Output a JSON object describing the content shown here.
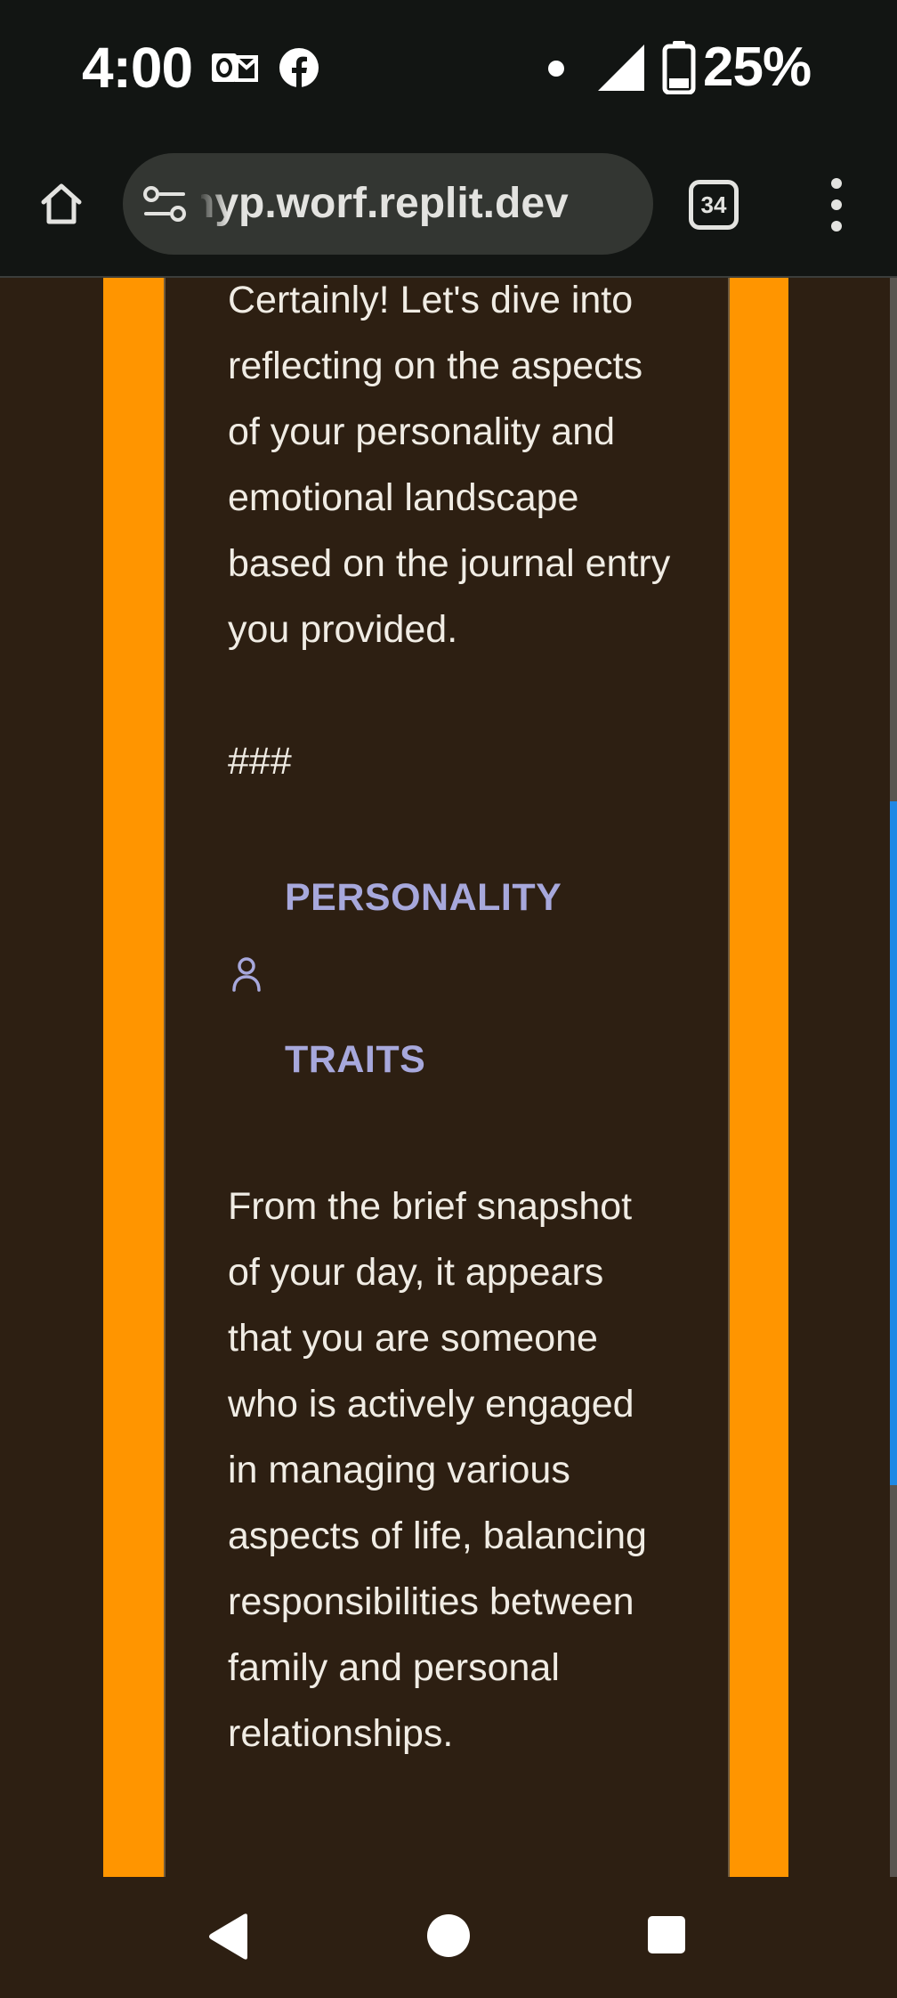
{
  "status_bar": {
    "time": "4:00",
    "battery_percent": "25%",
    "notification_icons": [
      "outlook-icon",
      "facebook-icon"
    ],
    "system_icons": [
      "dot-icon",
      "cell-signal-icon",
      "battery-icon"
    ]
  },
  "browser": {
    "url": "hyp.worf.replit.dev",
    "tab_count": "34",
    "icons": [
      "home-icon",
      "site-settings-icon",
      "tabs-icon",
      "more-vert-icon"
    ]
  },
  "content": {
    "intro": "Certainly! Let's dive into reflecting on the aspects of your personality and emotional landscape based on the journal entry you provided.",
    "hashes": "###",
    "section_heading": {
      "word1": "PERSONALITY",
      "word2": "TRAITS",
      "icon": "person-icon"
    },
    "paragraph": "From the brief snapshot of your day, it appears that you are someone who is actively engaged in managing various aspects of life, balancing responsibilities between family and personal relationships."
  },
  "colors": {
    "page_background": "#2d1f12",
    "accent_orange": "#ff9500",
    "heading_color": "#a7a8dc",
    "text_color": "#f0ece4",
    "scrollbar": "#1e88e5"
  },
  "nav_bar": {
    "icons": [
      "back-icon",
      "home-circle-icon",
      "recents-icon"
    ]
  }
}
